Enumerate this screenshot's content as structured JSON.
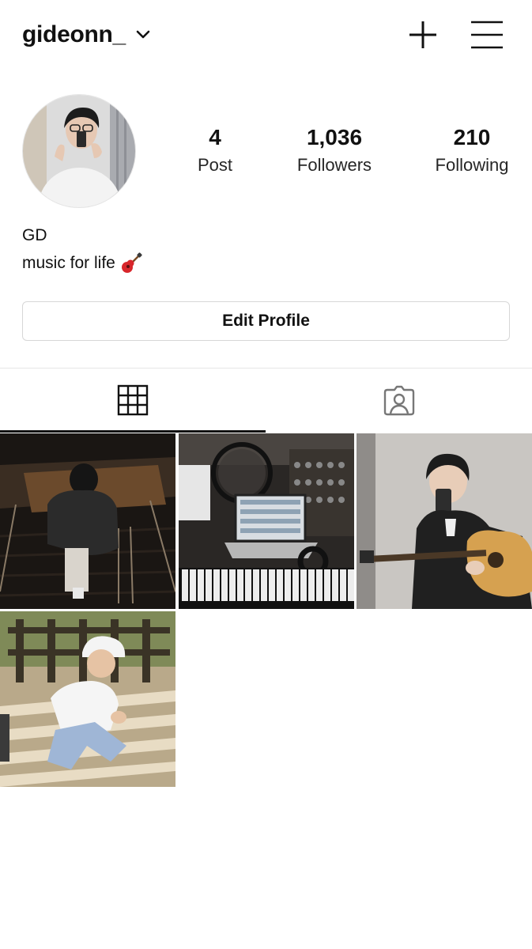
{
  "header": {
    "username": "gideonn_"
  },
  "profile": {
    "stats": [
      {
        "value": "4",
        "label": "Post"
      },
      {
        "value": "1,036",
        "label": "Followers"
      },
      {
        "value": "210",
        "label": "Following"
      }
    ],
    "display_name": "GD",
    "bio": "music for life",
    "bio_emoji": "guitar-icon",
    "edit_button_label": "Edit Profile"
  },
  "tabs": [
    {
      "icon": "grid-icon",
      "selected": true
    },
    {
      "icon": "tagged-person-icon",
      "selected": false
    }
  ],
  "posts": [
    {
      "subject": "person-on-stairs"
    },
    {
      "subject": "music-studio-laptop"
    },
    {
      "subject": "mirror-selfie-with-guitar"
    },
    {
      "subject": "child-in-cap"
    }
  ],
  "colors": {
    "text": "#111111",
    "border": "#d7d7d7",
    "divider": "#e6e6e6",
    "background": "#ffffff"
  }
}
